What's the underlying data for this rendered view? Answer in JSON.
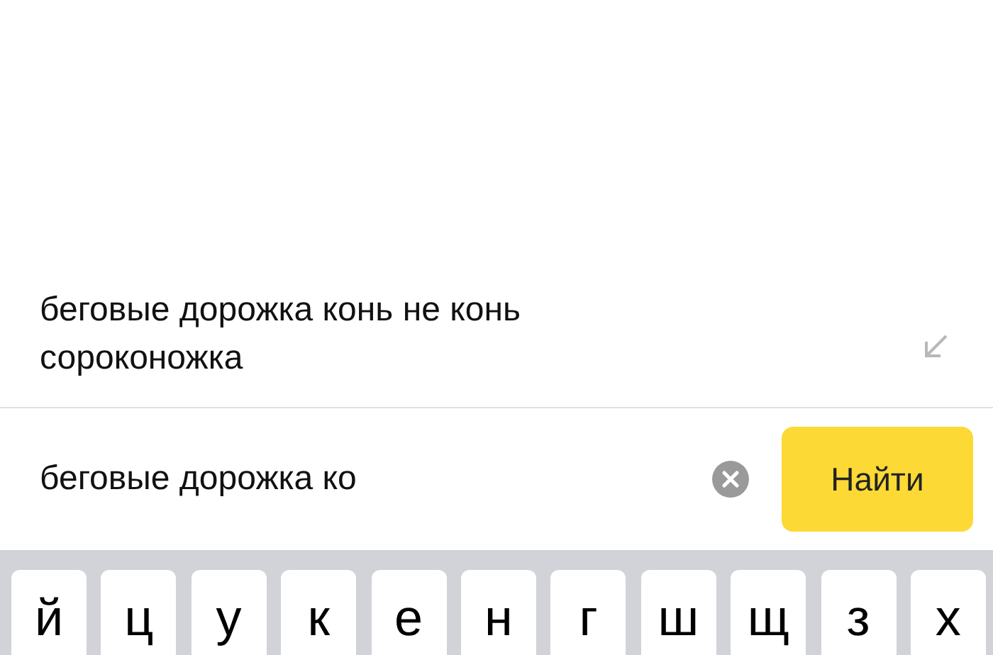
{
  "suggestion": {
    "text": "беговые дорожка конь не конь сороконожка"
  },
  "search": {
    "value": "беговые дорожка ко",
    "button": "Найти"
  },
  "keyboard": {
    "keys": [
      "й",
      "ц",
      "у",
      "к",
      "е",
      "н",
      "г",
      "ш",
      "щ",
      "з",
      "х"
    ]
  }
}
